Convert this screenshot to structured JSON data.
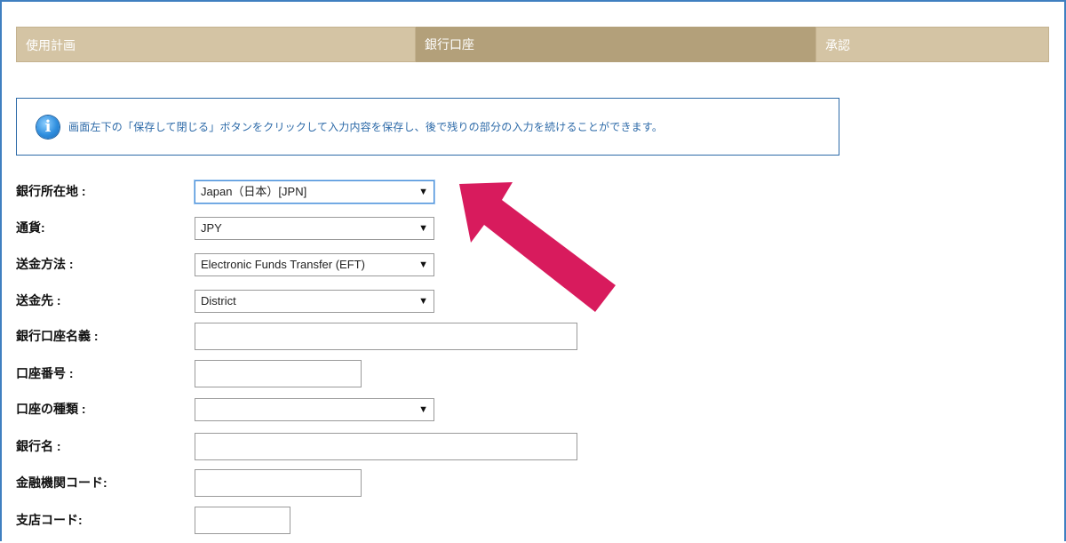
{
  "steps": [
    {
      "label": "使用計画"
    },
    {
      "label": "銀行口座"
    },
    {
      "label": "承認"
    }
  ],
  "info": {
    "icon": "info-icon",
    "icon_glyph": "i",
    "text": "画面左下の「保存して閉じる」ボタンをクリックして入力内容を保存し、後で残りの部分の入力を続けることができます。"
  },
  "form": {
    "bank_country": {
      "label": "銀行所在地 :",
      "value": "Japan（日本）[JPN]"
    },
    "currency": {
      "label": "通貨:",
      "value": "JPY"
    },
    "transfer_method": {
      "label": "送金方法 :",
      "value": "Electronic Funds Transfer (EFT)"
    },
    "destination": {
      "label": "送金先 :",
      "value": "District"
    },
    "account_holder": {
      "label": "銀行口座名義 :",
      "value": ""
    },
    "account_number": {
      "label": "口座番号 :",
      "value": ""
    },
    "account_type": {
      "label": "口座の種類 :",
      "value": ""
    },
    "bank_name": {
      "label": "銀行名 :",
      "value": ""
    },
    "institution_code": {
      "label": "金融機関コード:",
      "value": ""
    },
    "branch_code": {
      "label": "支店コード:",
      "value": ""
    }
  },
  "select_arrow": "▼",
  "colors": {
    "tab_inactive": "#d4c4a4",
    "tab_active": "#b3a07a",
    "info_border": "#2d6aa8",
    "highlight_arrow": "#d81b5d"
  }
}
